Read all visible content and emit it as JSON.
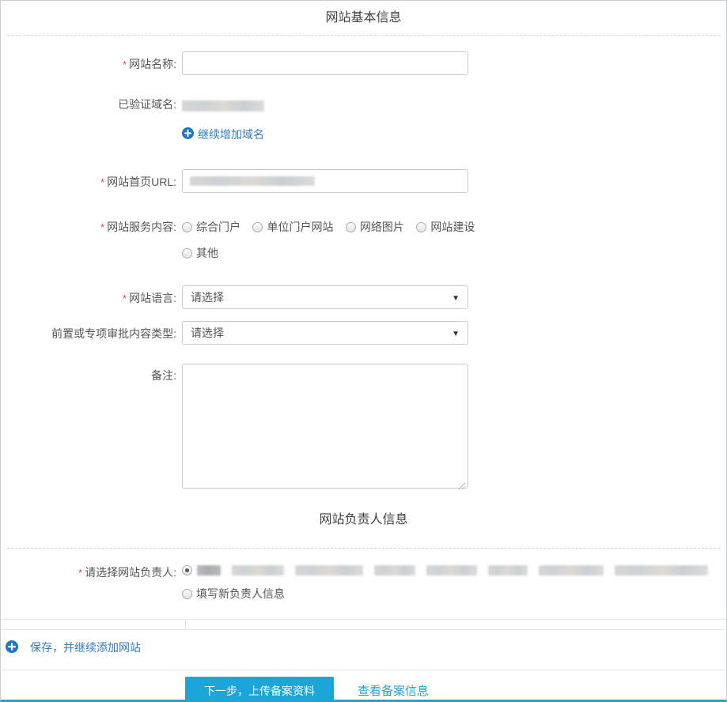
{
  "required_marker": "*",
  "sections": {
    "basic_title": "网站基本信息",
    "contact_title": "网站负责人信息"
  },
  "fields": {
    "site_name_label": "网站名称:",
    "site_name_value": "",
    "verified_domain_label": "已验证域名:",
    "add_domain_link": "继续增加域名",
    "homepage_url_label": "网站首页URL:",
    "service_content_label": "网站服务内容:",
    "service_options_row1": [
      "综合门户",
      "单位门户网站",
      "网络图片",
      "网站建设"
    ],
    "service_option_other": "其他",
    "language_label": "网站语言:",
    "language_value": "请选择",
    "approval_label": "前置或专项审批内容类型:",
    "approval_value": "请选择",
    "remark_label": "备注:",
    "remark_value": ""
  },
  "contact": {
    "select_label": "请选择网站负责人:",
    "new_person_label": "填写新负责人信息"
  },
  "actions": {
    "save_link": "保存，并继续添加网站",
    "next_button": "下一步，上传备案资料",
    "view_link": "查看备案信息"
  },
  "colors": {
    "accent_cyan": "#1ba5d9",
    "link_blue": "#2e7cc4",
    "required_red": "#e8414d"
  }
}
